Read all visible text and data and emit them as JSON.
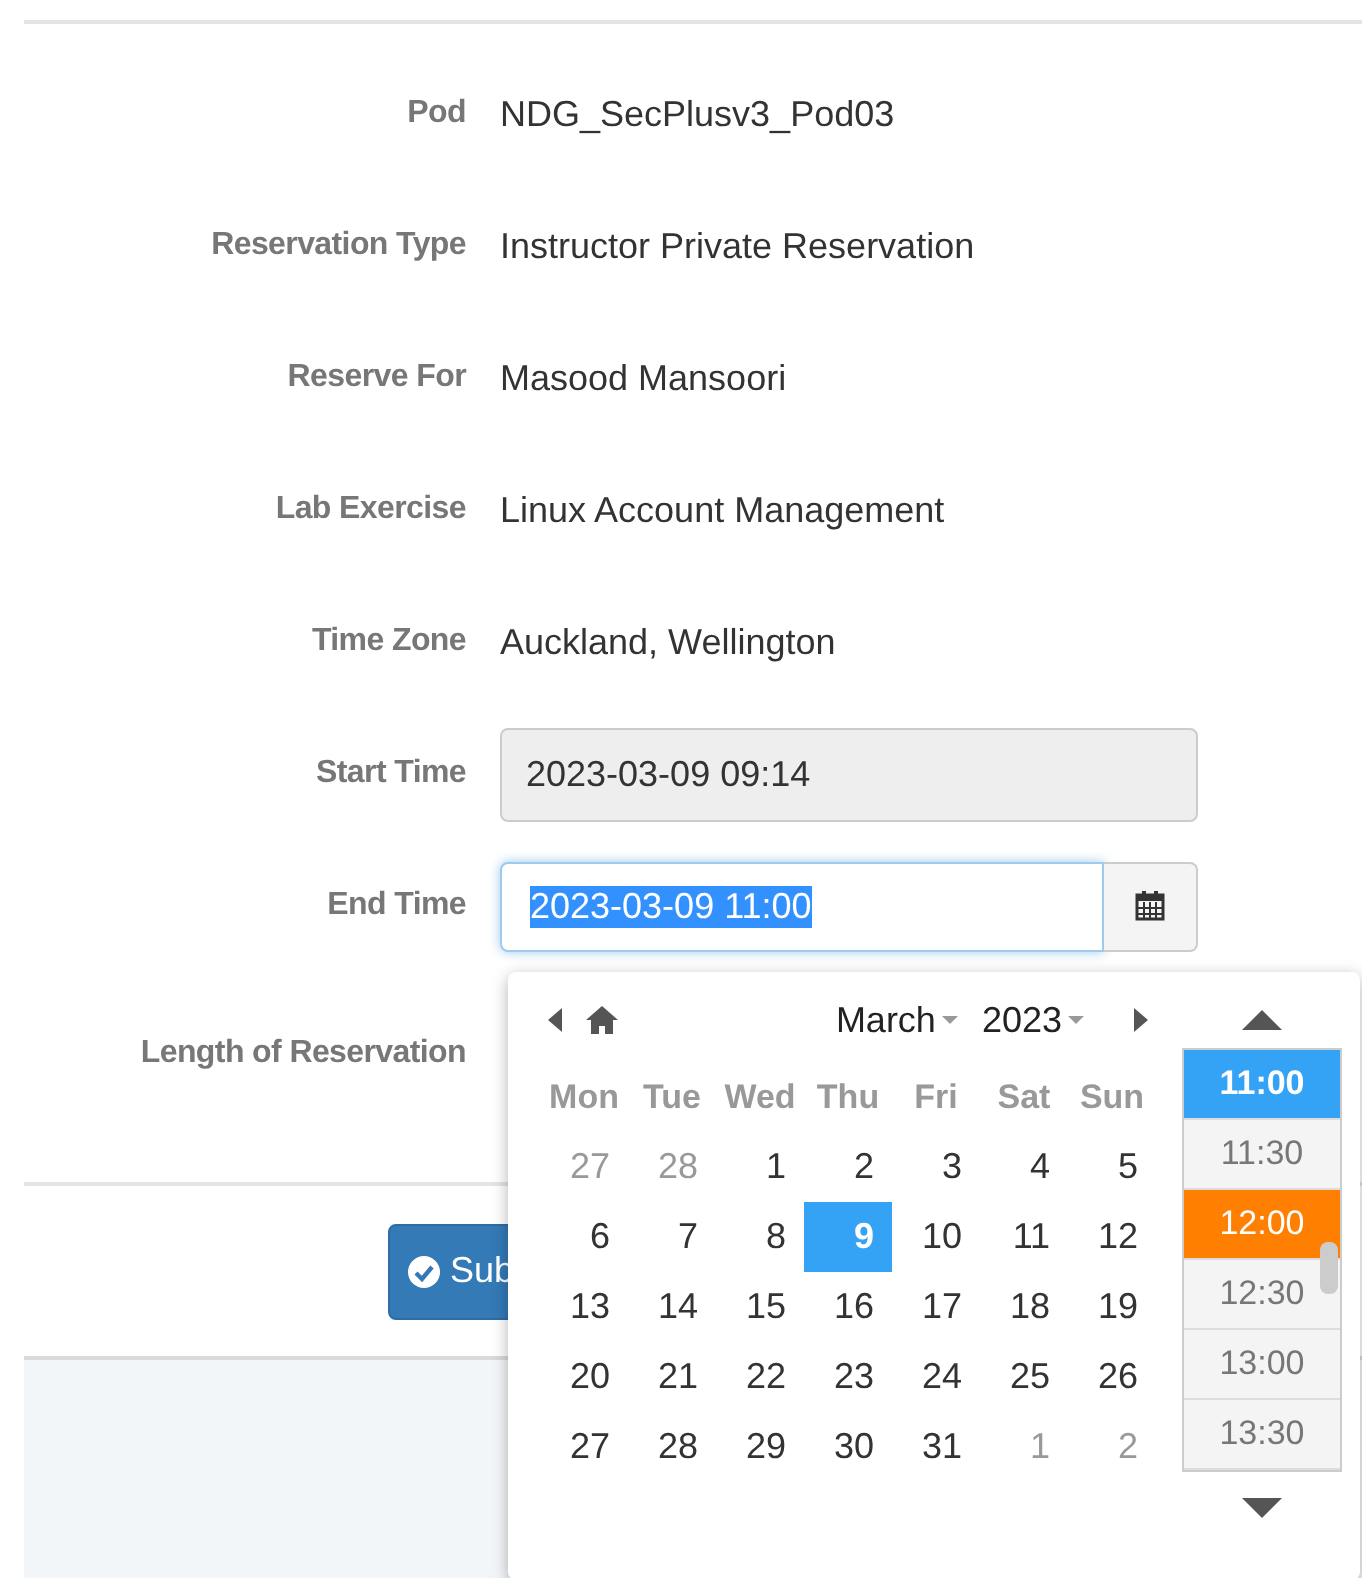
{
  "form": {
    "rows": [
      {
        "label": "Pod",
        "kind": "text",
        "value": "NDG_SecPlusv3_Pod03"
      },
      {
        "label": "Reservation Type",
        "kind": "text",
        "value": "Instructor Private Reservation"
      },
      {
        "label": "Reserve For",
        "kind": "text",
        "value": "Masood Mansoori"
      },
      {
        "label": "Lab Exercise",
        "kind": "text",
        "value": "Linux Account Management"
      },
      {
        "label": "Time Zone",
        "kind": "text",
        "value": "Auckland, Wellington"
      },
      {
        "label": "Start Time",
        "kind": "readonly",
        "value": "2023-03-09 09:14"
      },
      {
        "label": "End Time",
        "kind": "picker",
        "value": "2023-03-09 11:00",
        "text_selected": true
      },
      {
        "label": "Length of Reservation",
        "kind": "empty"
      }
    ]
  },
  "submit_button": {
    "label": "Sub"
  },
  "datepicker": {
    "month": "March",
    "year": "2023",
    "weekdays": [
      "Mon",
      "Tue",
      "Wed",
      "Thu",
      "Fri",
      "Sat",
      "Sun"
    ],
    "weeks": [
      [
        {
          "day": "27",
          "other_month": true,
          "selected": false
        },
        {
          "day": "28",
          "other_month": true,
          "selected": false
        },
        {
          "day": "1",
          "other_month": false,
          "selected": false
        },
        {
          "day": "2",
          "other_month": false,
          "selected": false
        },
        {
          "day": "3",
          "other_month": false,
          "selected": false
        },
        {
          "day": "4",
          "other_month": false,
          "selected": false
        },
        {
          "day": "5",
          "other_month": false,
          "selected": false
        }
      ],
      [
        {
          "day": "6",
          "other_month": false,
          "selected": false
        },
        {
          "day": "7",
          "other_month": false,
          "selected": false
        },
        {
          "day": "8",
          "other_month": false,
          "selected": false
        },
        {
          "day": "9",
          "other_month": false,
          "selected": true
        },
        {
          "day": "10",
          "other_month": false,
          "selected": false
        },
        {
          "day": "11",
          "other_month": false,
          "selected": false
        },
        {
          "day": "12",
          "other_month": false,
          "selected": false
        }
      ],
      [
        {
          "day": "13",
          "other_month": false,
          "selected": false
        },
        {
          "day": "14",
          "other_month": false,
          "selected": false
        },
        {
          "day": "15",
          "other_month": false,
          "selected": false
        },
        {
          "day": "16",
          "other_month": false,
          "selected": false
        },
        {
          "day": "17",
          "other_month": false,
          "selected": false
        },
        {
          "day": "18",
          "other_month": false,
          "selected": false
        },
        {
          "day": "19",
          "other_month": false,
          "selected": false
        }
      ],
      [
        {
          "day": "20",
          "other_month": false,
          "selected": false
        },
        {
          "day": "21",
          "other_month": false,
          "selected": false
        },
        {
          "day": "22",
          "other_month": false,
          "selected": false
        },
        {
          "day": "23",
          "other_month": false,
          "selected": false
        },
        {
          "day": "24",
          "other_month": false,
          "selected": false
        },
        {
          "day": "25",
          "other_month": false,
          "selected": false
        },
        {
          "day": "26",
          "other_month": false,
          "selected": false
        }
      ],
      [
        {
          "day": "27",
          "other_month": false,
          "selected": false
        },
        {
          "day": "28",
          "other_month": false,
          "selected": false
        },
        {
          "day": "29",
          "other_month": false,
          "selected": false
        },
        {
          "day": "30",
          "other_month": false,
          "selected": false
        },
        {
          "day": "31",
          "other_month": false,
          "selected": false
        },
        {
          "day": "1",
          "other_month": true,
          "selected": false
        },
        {
          "day": "2",
          "other_month": true,
          "selected": false
        }
      ]
    ],
    "times": [
      {
        "time": "11:00",
        "selected": true,
        "current": false
      },
      {
        "time": "11:30",
        "selected": false,
        "current": false
      },
      {
        "time": "12:00",
        "selected": false,
        "current": true
      },
      {
        "time": "12:30",
        "selected": false,
        "current": false
      },
      {
        "time": "13:00",
        "selected": false,
        "current": false
      },
      {
        "time": "13:30",
        "selected": false,
        "current": false
      }
    ]
  }
}
